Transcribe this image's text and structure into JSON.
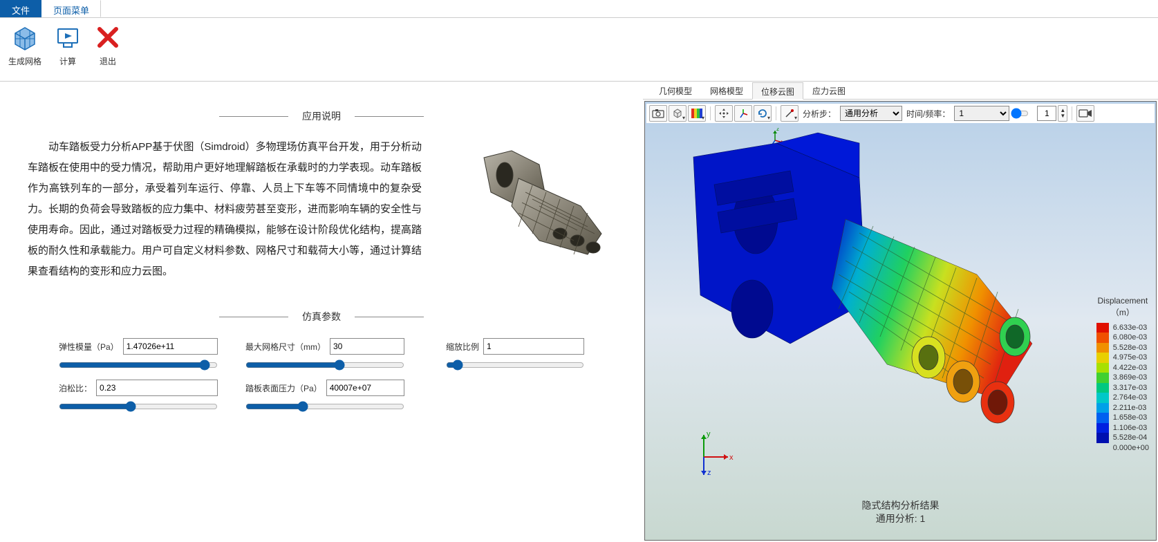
{
  "top_tabs": {
    "file": "文件",
    "page_menu": "页面菜单"
  },
  "ribbon": {
    "mesh": "生成网格",
    "compute": "计算",
    "exit": "退出"
  },
  "sections": {
    "desc_title": "应用说明",
    "params_title": "仿真参数"
  },
  "description": "动车踏板受力分析APP基于伏图（Simdroid）多物理场仿真平台开发，用于分析动车踏板在使用中的受力情况，帮助用户更好地理解踏板在承载时的力学表现。动车踏板作为高铁列车的一部分，承受着列车运行、停靠、人员上下车等不同情境中的复杂受力。长期的负荷会导致踏板的应力集中、材料疲劳甚至变形，进而影响车辆的安全性与使用寿命。因此，通过对踏板受力过程的精确模拟，能够在设计阶段优化结构，提高踏板的耐久性和承载能力。用户可自定义材料参数、网格尺寸和载荷大小等，通过计算结果查看结构的变形和应力云图。",
  "params": {
    "youngs": {
      "label": "弹性模量（Pa）",
      "value": "1.47026e+11"
    },
    "poisson": {
      "label": "泊松比：",
      "value": "0.23"
    },
    "mesh_size": {
      "label": "最大网格尺寸（mm）",
      "value": "30"
    },
    "pressure": {
      "label": "踏板表面压力（Pa）",
      "value": "40007e+07"
    },
    "scale": {
      "label": "缩放比例",
      "value": "1"
    }
  },
  "view_tabs": {
    "geom": "几何模型",
    "mesh": "网格模型",
    "disp": "位移云图",
    "stress": "应力云图"
  },
  "toolbar": {
    "step_label": "分析步：",
    "step_value": "通用分析",
    "time_label": "时间/频率：",
    "time_value": "1",
    "frame_value": "1"
  },
  "legend": {
    "title": "Displacement",
    "unit": "（m）",
    "values": [
      "6.633e-03",
      "6.080e-03",
      "5.528e-03",
      "4.975e-03",
      "4.422e-03",
      "3.869e-03",
      "3.317e-03",
      "2.764e-03",
      "2.211e-03",
      "1.658e-03",
      "1.106e-03",
      "5.528e-04",
      "0.000e+00"
    ]
  },
  "analysis": {
    "line1": "隐式结构分析结果",
    "line2": "通用分析: 1"
  },
  "axes": {
    "x": "x",
    "y": "y",
    "z": "z"
  }
}
